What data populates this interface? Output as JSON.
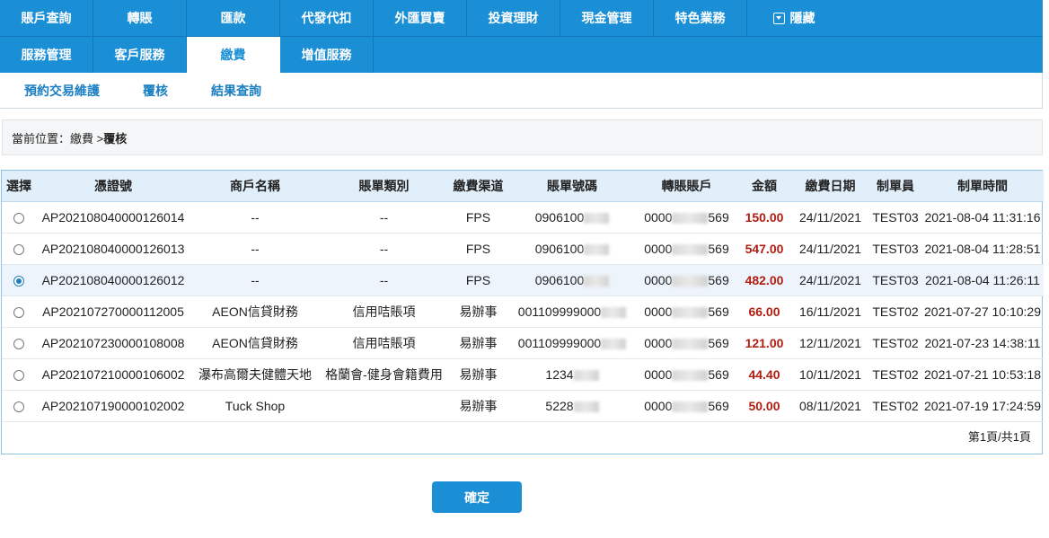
{
  "nav": {
    "row1": [
      "賬戶查詢",
      "轉賬",
      "匯款",
      "代發代扣",
      "外匯買賣",
      "投資理財",
      "現金管理",
      "特色業務"
    ],
    "hide_label": "隱藏",
    "row2": [
      "服務管理",
      "客戶服務",
      "繳費",
      "增值服務"
    ],
    "active_tab": "繳費"
  },
  "subnav": [
    "預約交易維護",
    "覆核",
    "結果查詢"
  ],
  "breadcrumb": {
    "prefix": "當前位置：",
    "path": "繳費 > ",
    "current": "覆核"
  },
  "table": {
    "headers": [
      "選擇",
      "憑證號",
      "商戶名稱",
      "賬單類別",
      "繳費渠道",
      "賬單號碼",
      "轉賬賬戶",
      "金額",
      "繳費日期",
      "制單員",
      "制單時間"
    ],
    "rows": [
      {
        "selected": false,
        "voucher": "AP202108040000126014",
        "merchant": "--",
        "bill_type": "--",
        "channel": "FPS",
        "bill_no": "0906100",
        "account_pre": "0000",
        "account_post": "569",
        "amount": "150.00",
        "date": "24/11/2021",
        "maker": "TEST03",
        "time": "2021-08-04 11:31:16"
      },
      {
        "selected": false,
        "voucher": "AP202108040000126013",
        "merchant": "--",
        "bill_type": "--",
        "channel": "FPS",
        "bill_no": "0906100",
        "account_pre": "0000",
        "account_post": "569",
        "amount": "547.00",
        "date": "24/11/2021",
        "maker": "TEST03",
        "time": "2021-08-04 11:28:51"
      },
      {
        "selected": true,
        "voucher": "AP202108040000126012",
        "merchant": "--",
        "bill_type": "--",
        "channel": "FPS",
        "bill_no": "0906100",
        "account_pre": "0000",
        "account_post": "569",
        "amount": "482.00",
        "date": "24/11/2021",
        "maker": "TEST03",
        "time": "2021-08-04 11:26:11"
      },
      {
        "selected": false,
        "voucher": "AP202107270000112005",
        "merchant": "AEON信貸財務",
        "bill_type": "信用咭賬項",
        "channel": "易辦事",
        "bill_no": "001109999000",
        "account_pre": "0000",
        "account_post": "569",
        "amount": "66.00",
        "date": "16/11/2021",
        "maker": "TEST02",
        "time": "2021-07-27 10:10:29"
      },
      {
        "selected": false,
        "voucher": "AP202107230000108008",
        "merchant": "AEON信貸財務",
        "bill_type": "信用咭賬項",
        "channel": "易辦事",
        "bill_no": "001109999000",
        "account_pre": "0000",
        "account_post": "569",
        "amount": "121.00",
        "date": "12/11/2021",
        "maker": "TEST02",
        "time": "2021-07-23 14:38:11"
      },
      {
        "selected": false,
        "voucher": "AP202107210000106002",
        "merchant": "瀑布高爾夫健體天地",
        "bill_type": "格蘭會-健身會籍費用",
        "channel": "易辦事",
        "bill_no": "1234",
        "account_pre": "0000",
        "account_post": "569",
        "amount": "44.40",
        "date": "10/11/2021",
        "maker": "TEST02",
        "time": "2021-07-21 10:53:18"
      },
      {
        "selected": false,
        "voucher": "AP202107190000102002",
        "merchant": "Tuck Shop",
        "bill_type": "",
        "channel": "易辦事",
        "bill_no": "5228",
        "account_pre": "0000",
        "account_post": "569",
        "amount": "50.00",
        "date": "08/11/2021",
        "maker": "TEST02",
        "time": "2021-07-19 17:24:59"
      }
    ],
    "pager": "第1頁/共1頁"
  },
  "confirm_label": "確定",
  "colors": {
    "primary": "#1a8fd6",
    "amount": "#b01e12",
    "header_bg": "#e1effa"
  }
}
